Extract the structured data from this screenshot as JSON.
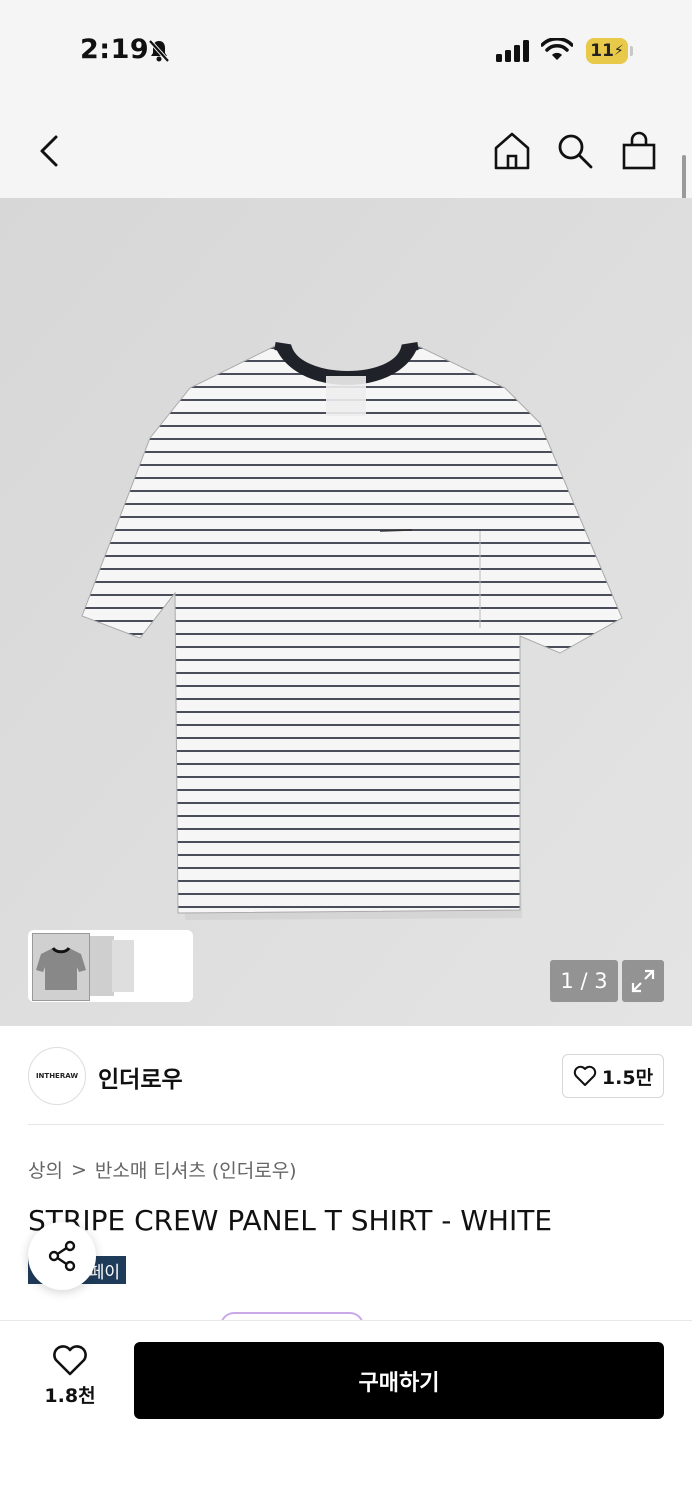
{
  "status_bar": {
    "time": "2:19",
    "battery": "11"
  },
  "gallery": {
    "counter": "1 / 3"
  },
  "brand": {
    "logo_text": "INTHERAW",
    "name": "인더로우",
    "likes": "1.5만"
  },
  "breadcrumb": {
    "category": "상의",
    "separator": ">",
    "subcategory": "반소매 티셔츠 (인더로우)"
  },
  "product": {
    "title": "STRIPE CREW PANEL T SHIRT - WHITE",
    "badge": "페이"
  },
  "bottom_bar": {
    "wish_count": "1.8천",
    "buy_label": "구매하기"
  },
  "colors": {
    "accent": "#000000",
    "badge": "#1f3b5a",
    "battery": "#e9c94a"
  }
}
